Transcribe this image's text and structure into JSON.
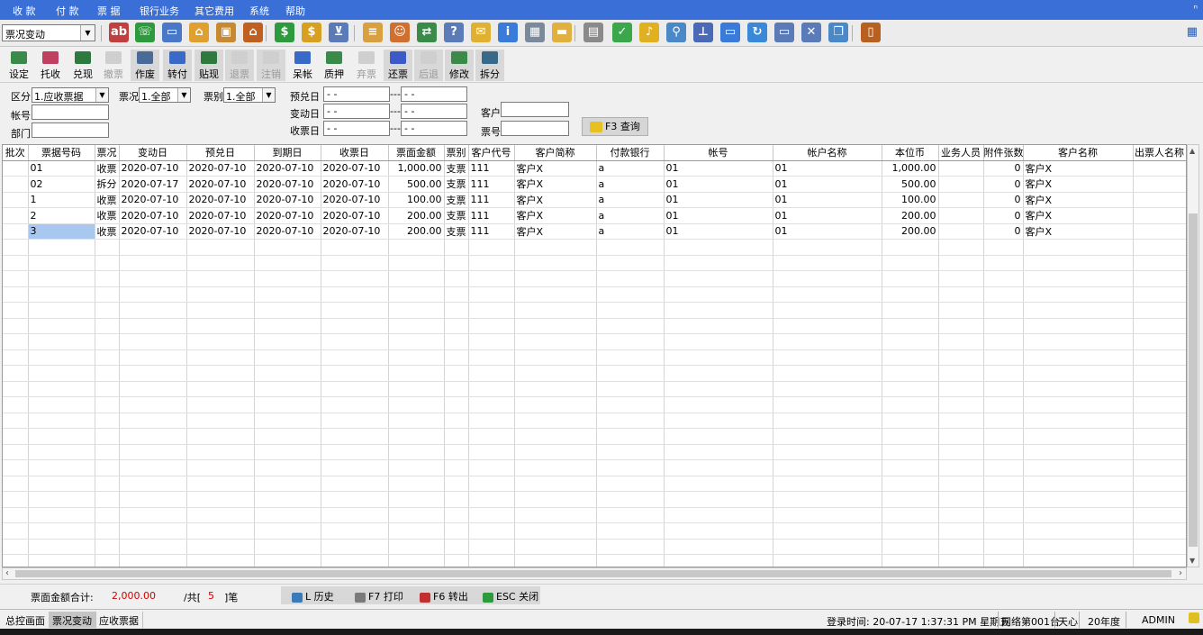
{
  "menu": [
    "收 款",
    "付 款",
    "票 据",
    "银行业务",
    "其它费用",
    "系统",
    "帮助"
  ],
  "menu_corner": "ⁿ",
  "module_select": "票况变动",
  "toolbar_icons": [
    {
      "name": "abc-icon",
      "color": "#c04040",
      "glyph": "ab"
    },
    {
      "name": "phone-icon",
      "color": "#2e9a3e",
      "glyph": "☏"
    },
    {
      "name": "computer-icon",
      "color": "#4a78c8",
      "glyph": "▭"
    },
    {
      "name": "lock-icon",
      "color": "#e0a030",
      "glyph": "⌂"
    },
    {
      "name": "briefcase-icon",
      "color": "#c88a30",
      "glyph": "▣"
    },
    {
      "name": "home-icon",
      "color": "#c06020",
      "glyph": "⌂"
    },
    {
      "name": "dollar-icon",
      "color": "#2e9a3e",
      "glyph": "$"
    },
    {
      "name": "money-bag-icon",
      "color": "#d8a020",
      "glyph": "$"
    },
    {
      "name": "cart-icon",
      "color": "#5a7ab8",
      "glyph": "⊻"
    },
    {
      "name": "clipboard-icon",
      "color": "#d8a040",
      "glyph": "≡"
    },
    {
      "name": "users-icon",
      "color": "#d07030",
      "glyph": "☺"
    },
    {
      "name": "transfer-icon",
      "color": "#3a8a4a",
      "glyph": "⇄"
    },
    {
      "name": "help-doc-icon",
      "color": "#5a7ab8",
      "glyph": "?"
    },
    {
      "name": "mail-icon",
      "color": "#e0b030",
      "glyph": "✉"
    },
    {
      "name": "info-icon",
      "color": "#3a7ad8",
      "glyph": "i"
    },
    {
      "name": "calculator-icon",
      "color": "#7a8a9a",
      "glyph": "▦"
    },
    {
      "name": "folder-icon",
      "color": "#e0b040",
      "glyph": "▬"
    },
    {
      "name": "document-icon",
      "color": "#8a8a8a",
      "glyph": "▤"
    },
    {
      "name": "check-icon",
      "color": "#3aa84a",
      "glyph": "✓"
    },
    {
      "name": "bell-icon",
      "color": "#e0b020",
      "glyph": "♪"
    },
    {
      "name": "search-icon",
      "color": "#4a88c8",
      "glyph": "⚲"
    },
    {
      "name": "org-chart-icon",
      "color": "#4a6ab8",
      "glyph": "⊥"
    },
    {
      "name": "monitor-icon",
      "color": "#3a7ad8",
      "glyph": "▭"
    },
    {
      "name": "refresh-icon",
      "color": "#3a88d8",
      "glyph": "↻"
    },
    {
      "name": "window-icon",
      "color": "#5a7ab8",
      "glyph": "▭"
    },
    {
      "name": "close-window-icon",
      "color": "#5a7ab8",
      "glyph": "✕"
    },
    {
      "name": "restore-icon",
      "color": "#4a88c8",
      "glyph": "❐"
    },
    {
      "name": "exit-door-icon",
      "color": "#b86020",
      "glyph": "▯"
    }
  ],
  "side_icon": "▦",
  "actions": [
    {
      "name": "settings-button",
      "label": "设定",
      "color": "#3a8a4a",
      "enabled": true,
      "grp": false
    },
    {
      "name": "consign-button",
      "label": "托收",
      "color": "#c04060",
      "enabled": true,
      "grp": false
    },
    {
      "name": "redeem-button",
      "label": "兑现",
      "color": "#2e7a3e",
      "enabled": true,
      "grp": false
    },
    {
      "name": "withdraw-button",
      "label": "撤票",
      "color": "#9a9a9a",
      "enabled": false,
      "grp": false
    },
    {
      "name": "void-button",
      "label": "作废",
      "color": "#4a6a98",
      "enabled": true,
      "grp": true
    },
    {
      "name": "endorse-button",
      "label": "转付",
      "color": "#3a6ac8",
      "enabled": true,
      "grp": true
    },
    {
      "name": "discount-button",
      "label": "贴现",
      "color": "#2e7a3e",
      "enabled": true,
      "grp": true
    },
    {
      "name": "return-button",
      "label": "退票",
      "color": "#9a9a9a",
      "enabled": false,
      "grp": true
    },
    {
      "name": "cancel-button",
      "label": "注销",
      "color": "#9a9a9a",
      "enabled": false,
      "grp": true
    },
    {
      "name": "bad-debt-button",
      "label": "呆帐",
      "color": "#3a6ac8",
      "enabled": true,
      "grp": false
    },
    {
      "name": "pledge-button",
      "label": "质押",
      "color": "#3a8a4a",
      "enabled": true,
      "grp": false
    },
    {
      "name": "abandon-button",
      "label": "弃票",
      "color": "#9a9a9a",
      "enabled": false,
      "grp": false
    },
    {
      "name": "return-ticket-button",
      "label": "还票",
      "color": "#3a5ac8",
      "enabled": true,
      "grp": true
    },
    {
      "name": "back-button",
      "label": "后退",
      "color": "#9a9a9a",
      "enabled": false,
      "grp": true
    },
    {
      "name": "modify-button",
      "label": "修改",
      "color": "#3a8a4a",
      "enabled": true,
      "grp": true
    },
    {
      "name": "split-button",
      "label": "拆分",
      "color": "#3a6a8a",
      "enabled": true,
      "grp": true
    }
  ],
  "filter": {
    "category_label": "区分",
    "category_value": "1.应收票据",
    "status_label": "票况",
    "status_value": "1.全部",
    "type_label": "票别",
    "type_value": "1.全部",
    "account_label": "帐号",
    "dept_label": "部门",
    "due_label": "预兑日",
    "change_label": "变动日",
    "receive_label": "收票日",
    "date_blank": "  -  -",
    "range_dash": "---",
    "customer_label": "客户",
    "ticket_label": "票号",
    "query_label": "F3 查询"
  },
  "table": {
    "columns": [
      "批次",
      "票据号码",
      "票况",
      "变动日",
      "预兑日",
      "到期日",
      "收票日",
      "票面金额",
      "票别",
      "客户代号",
      "客户简称",
      "付款银行",
      "帐号",
      "帐户名称",
      "本位币",
      "业务人员",
      "附件张数",
      "客户名称",
      "出票人名称"
    ],
    "rows": [
      [
        "",
        "01",
        "收票",
        "2020-07-10",
        "2020-07-10",
        "2020-07-10",
        "2020-07-10",
        "1,000.00",
        "支票",
        "111",
        "客户X",
        "a",
        "01",
        "01",
        "1,000.00",
        "",
        "0",
        "客户X",
        ""
      ],
      [
        "",
        "02",
        "拆分",
        "2020-07-17",
        "2020-07-10",
        "2020-07-10",
        "2020-07-10",
        "500.00",
        "支票",
        "111",
        "客户X",
        "a",
        "01",
        "01",
        "500.00",
        "",
        "0",
        "客户X",
        ""
      ],
      [
        "",
        "1",
        "收票",
        "2020-07-10",
        "2020-07-10",
        "2020-07-10",
        "2020-07-10",
        "100.00",
        "支票",
        "111",
        "客户X",
        "a",
        "01",
        "01",
        "100.00",
        "",
        "0",
        "客户X",
        ""
      ],
      [
        "",
        "2",
        "收票",
        "2020-07-10",
        "2020-07-10",
        "2020-07-10",
        "2020-07-10",
        "200.00",
        "支票",
        "111",
        "客户X",
        "a",
        "01",
        "01",
        "200.00",
        "",
        "0",
        "客户X",
        ""
      ],
      [
        "",
        "3",
        "收票",
        "2020-07-10",
        "2020-07-10",
        "2020-07-10",
        "2020-07-10",
        "200.00",
        "支票",
        "111",
        "客户X",
        "a",
        "01",
        "01",
        "200.00",
        "",
        "0",
        "客户X",
        ""
      ]
    ],
    "selected_row": 4,
    "selected_col": 1
  },
  "summary": {
    "total_label": "票面金额合计:",
    "total_value": "2,000.00",
    "count_prefix": "/共[",
    "count_value": "5",
    "count_suffix": "]笔",
    "history_label": "L 历史",
    "print_label": "F7 打印",
    "export_label": "F6 转出",
    "close_label": "ESC 关闭"
  },
  "status": {
    "tabs": [
      "总控画面",
      "票况变动",
      "应收票据"
    ],
    "active_tab": 1,
    "login_time": "登录时间: 20-07-17 1:37:31 PM  星期五",
    "network": "网络第001台",
    "company": "天心",
    "year": "20年度",
    "user": "ADMIN"
  },
  "colors": {
    "menubar": "#3a6fd8",
    "selection": "#a8c8f0",
    "total": "#d00000"
  }
}
